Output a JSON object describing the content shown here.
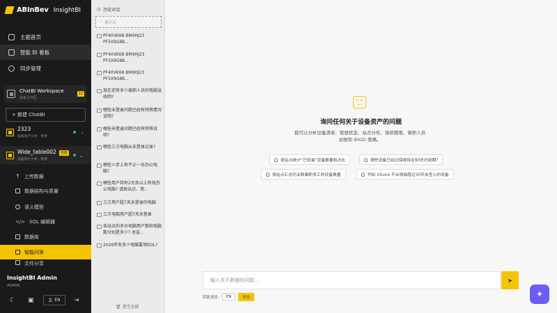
{
  "brand": {
    "logo": "ABInBev",
    "app": "InsightBI"
  },
  "nav": [
    {
      "label": "主题首页",
      "icon": "home-icon"
    },
    {
      "label": "智能 BI 看板",
      "icon": "dashboard-icon"
    },
    {
      "label": "同步管理",
      "icon": "sync-icon"
    }
  ],
  "workspace": {
    "title": "ChatBI Workspace",
    "sub": "看板工作区",
    "badge": "12"
  },
  "new_button": "+ 新建 ChatBI",
  "projects": [
    {
      "title": "2323",
      "sub": "设备资产分析 · 英博"
    },
    {
      "title": "Wide_table002",
      "sub": "设备资产分析 · 英博",
      "badge": "当前"
    }
  ],
  "sub_menu": [
    {
      "label": "上传数据"
    },
    {
      "label": "数据结构与质量"
    },
    {
      "label": "语义模型"
    },
    {
      "label": "SQL 编辑器"
    },
    {
      "label": "数据库"
    },
    {
      "label": "智能问答"
    },
    {
      "label": "文件分享"
    }
  ],
  "user": {
    "name": "InsightBI Admin",
    "role": "ADMIN",
    "lang": "EN"
  },
  "history": {
    "header": "历史对话",
    "search_placeholder": "搜对话",
    "items": [
      "PF40VK68 BM9HJ23 PF5X9G88...",
      "PF40VK68 BM9HJ23 PF5X9G88...",
      "PF40VK68 BM9HJ23 PF5X9G88...",
      "现在还有多少离职人员的电脑没收回?",
      "哪些未登录问题已经有特殊情况说明?",
      "哪些未登录问题已经有特殊说明?",
      "哪些三方电脑从未登录记录?",
      "哪些人手上有不止一台办公电脑?",
      "哪些用户持有2台及以上有效办公电脑? 请按站点、用...",
      "三方用户超7天未登录的电脑",
      "三方电脑用户超7天未登录",
      "各站点的多台电脑用户数和电脑数分别是多少? 总监...",
      "2026年有多少电脑要到EOL?"
    ],
    "clear": "清空全部"
  },
  "main": {
    "title": "询问任何关于设备资产的问题",
    "desc": "我可以分析设备清单、管理状态、站点分布、保修期限、离职人员关联和 BYOD 策略。",
    "suggestions": [
      "按站点统计“已安装”设备数量和占比",
      "哪些设备已经过保或将在90天内到期?",
      "按站点汇总仍关联离职员工的设备数量",
      "列出 Intune 不合规或超过30天未签入的设备"
    ],
    "input_placeholder": "输入关于数据的问题...",
    "reply_lang_label": "回复语言:",
    "langs": [
      "EN",
      "中文"
    ]
  }
}
